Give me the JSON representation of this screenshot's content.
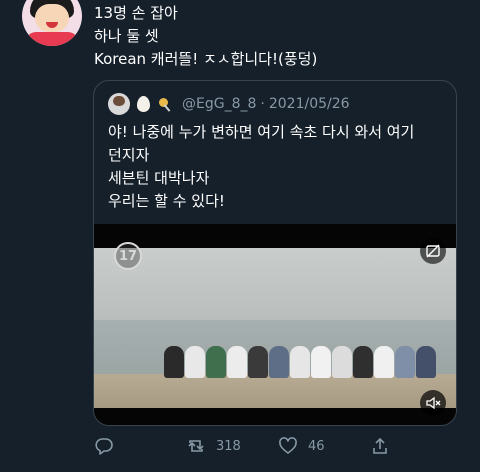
{
  "tweet": {
    "lines": [
      "13명 손 잡아",
      "하나 둘 셋",
      "Korean 캐러뜰! ㅈㅅ합니다!(풍덩)"
    ]
  },
  "quoted": {
    "handle": "@EgG_8_8",
    "separator": "·",
    "date": "2021/05/26",
    "emoji_icons": [
      "egg-icon",
      "spoon-icon"
    ],
    "lines": [
      "야! 나중에 누가 변하면 여기 속초 다시 와서 여기",
      "던지자",
      "세븐틴 대박나자",
      "우리는 할 수 있다!"
    ]
  },
  "video": {
    "logo_text": "17",
    "colors": {
      "sky": "#c9cdcb",
      "sea": "#a7b0b0",
      "sand": "#b7ab94"
    }
  },
  "actions": {
    "reply_count": "",
    "retweet_count": "318",
    "like_count": "46"
  },
  "colors": {
    "background": "#15202b",
    "border": "#38444d",
    "muted_text": "#8899a6"
  }
}
